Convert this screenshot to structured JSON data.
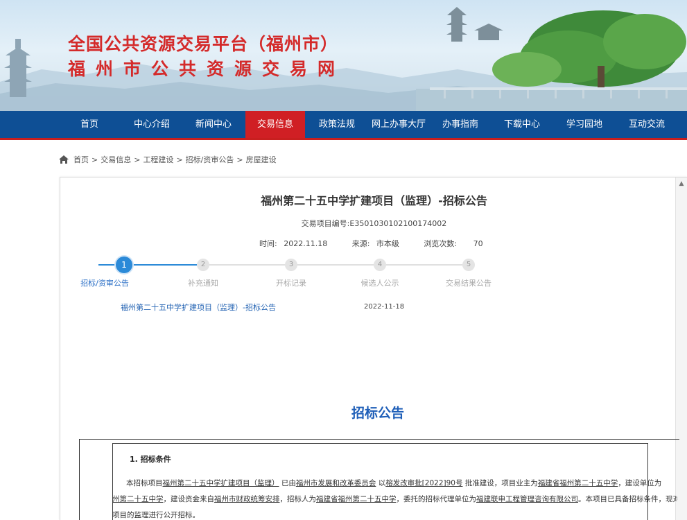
{
  "site": {
    "title_line1": "全国公共资源交易平台（福州市）",
    "title_line2": "福州市公共资源交易网"
  },
  "nav": {
    "items": [
      {
        "label": "首页"
      },
      {
        "label": "中心介绍"
      },
      {
        "label": "新闻中心"
      },
      {
        "label": "交易信息"
      },
      {
        "label": "政策法规"
      },
      {
        "label": "网上办事大厅"
      },
      {
        "label": "办事指南"
      },
      {
        "label": "下载中心"
      },
      {
        "label": "学习园地"
      },
      {
        "label": "互动交流"
      }
    ],
    "active": "交易信息"
  },
  "breadcrumb": {
    "items": [
      "首页",
      "交易信息",
      "工程建设",
      "招标/资审公告",
      "房屋建设"
    ],
    "separator": ">"
  },
  "article": {
    "title": "福州第二十五中学扩建项目（监理）-招标公告",
    "code": "交易项目编号:E3501030102100174002",
    "time_label": "时间:",
    "time_value": "2022.11.18",
    "source_label": "来源:",
    "source_value": "市本级",
    "views_label": "浏览次数:",
    "views_value": "70"
  },
  "steps": {
    "items": [
      {
        "num": "1",
        "label": "招标/资审公告"
      },
      {
        "num": "2",
        "label": "补充通知"
      },
      {
        "num": "3",
        "label": "开标记录"
      },
      {
        "num": "4",
        "label": "候选人公示"
      },
      {
        "num": "5",
        "label": "交易结果公告"
      }
    ],
    "current": 1
  },
  "notice_list": [
    {
      "title": "福州第二十五中学扩建项目（监理）-招标公告",
      "date": "2022-11-18"
    }
  ],
  "document": {
    "heading": "招标公告",
    "section1_title": "1. 招标条件",
    "p_lead": "本招标项目",
    "p_project": "福州第二十五中学扩建项目（监理）",
    "p_t1": "已由",
    "p_approver": "福州市发展和改革委员会",
    "p_t2": "以",
    "p_doc": "榕发改审批[2022]90号",
    "p_t3": "批准建设，项目业主为",
    "p_owner": "福建省福州第二十五中学",
    "p_t4": "，建设单位为",
    "p_line2_start": "州第二十五中学",
    "p_t5": "，建设资金来自",
    "p_fund": "福州市财政统筹安排",
    "p_t6": "，招标人为",
    "p_tenderer": "福建省福州第二十五中学",
    "p_t7": "，委托的招标代理单位为",
    "p_agent": "福建联申工程管理咨询有限公司",
    "p_t8": "。本项目已具备招标条件，现对该",
    "p_line3": "项目的监理进行公开招标。"
  }
}
